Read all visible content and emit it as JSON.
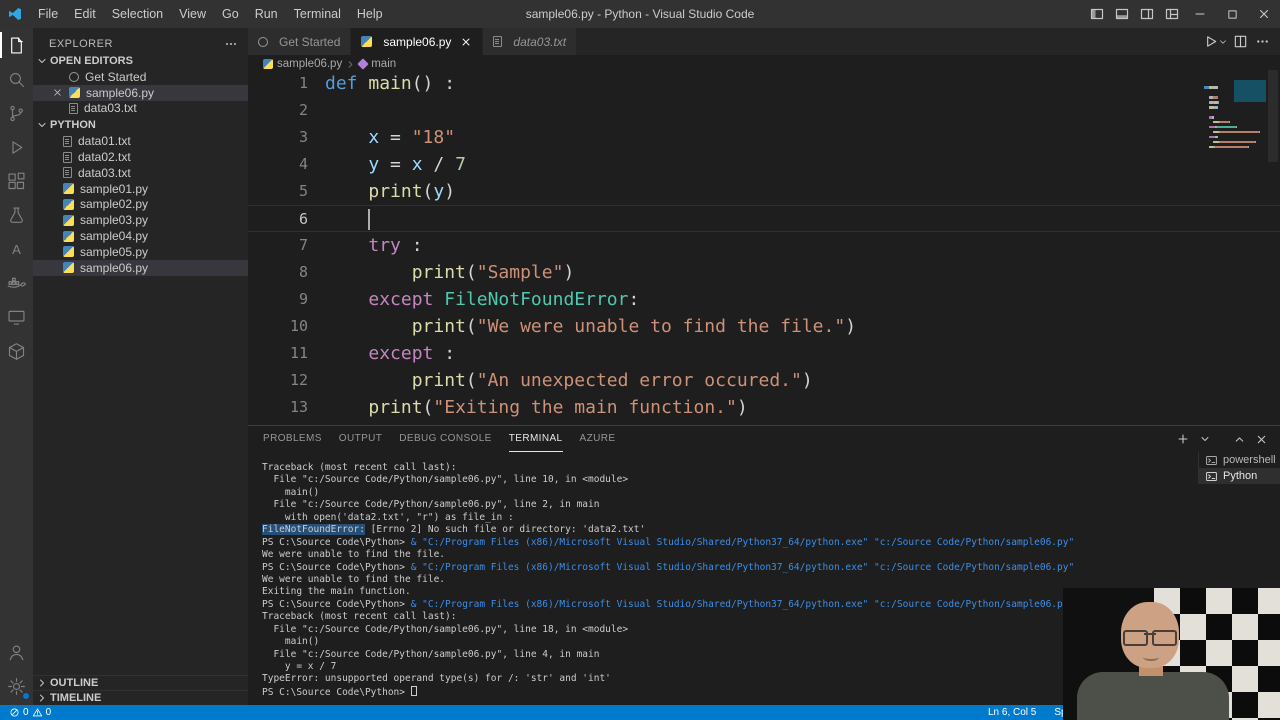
{
  "colors": {
    "accent": "#007acc",
    "python_icon_blue": "#4584b6",
    "python_icon_yellow": "#ffde57",
    "selection_highlight": "#264f78"
  },
  "title_bar": {
    "title": "sample06.py - Python - Visual Studio Code",
    "menus": [
      "File",
      "Edit",
      "Selection",
      "View",
      "Go",
      "Run",
      "Terminal",
      "Help"
    ]
  },
  "activity_bar": {
    "top": [
      {
        "name": "explorer",
        "icon": "explorer",
        "active": true
      },
      {
        "name": "search",
        "icon": "search"
      },
      {
        "name": "source-control",
        "icon": "source-control"
      },
      {
        "name": "run-and-debug",
        "icon": "run-debug"
      },
      {
        "name": "extensions",
        "icon": "extensions"
      },
      {
        "name": "testing",
        "icon": "testing"
      },
      {
        "name": "azure",
        "icon": "azure"
      },
      {
        "name": "docker",
        "icon": "docker"
      },
      {
        "name": "remote-explorer",
        "icon": "remote"
      },
      {
        "name": "package-explorer",
        "icon": "package"
      }
    ],
    "bottom": [
      {
        "name": "account",
        "icon": "account"
      },
      {
        "name": "settings",
        "icon": "settings",
        "badge": true
      }
    ]
  },
  "sidebar": {
    "header": "EXPLORER",
    "open_editors": {
      "label": "OPEN EDITORS",
      "items": [
        {
          "name": "Get Started",
          "icon": "gs"
        },
        {
          "name": "sample06.py",
          "icon": "py",
          "selected": true,
          "close_visible": true
        },
        {
          "name": "data03.txt",
          "icon": "txt"
        }
      ]
    },
    "folder": {
      "label": "PYTHON",
      "files": [
        {
          "name": "data01.txt",
          "icon": "txt"
        },
        {
          "name": "data02.txt",
          "icon": "txt"
        },
        {
          "name": "data03.txt",
          "icon": "txt"
        },
        {
          "name": "sample01.py",
          "icon": "py"
        },
        {
          "name": "sample02.py",
          "icon": "py"
        },
        {
          "name": "sample03.py",
          "icon": "py"
        },
        {
          "name": "sample04.py",
          "icon": "py"
        },
        {
          "name": "sample05.py",
          "icon": "py"
        },
        {
          "name": "sample06.py",
          "icon": "py",
          "selected": true
        }
      ]
    },
    "outline_label": "OUTLINE",
    "timeline_label": "TIMELINE"
  },
  "editor": {
    "tabs": [
      {
        "label": "Get Started",
        "icon": "gs",
        "state": "inactive"
      },
      {
        "label": "sample06.py",
        "icon": "py",
        "state": "active"
      },
      {
        "label": "data03.txt",
        "icon": "txt",
        "state": "preview"
      }
    ],
    "breadcrumb": [
      {
        "label": "sample06.py",
        "icon": "python"
      },
      {
        "label": "main",
        "icon": "symbol-method"
      }
    ],
    "cursor": {
      "line": 6,
      "col": 5
    },
    "code_lines": [
      {
        "num": 1,
        "indent": 0,
        "tokens": [
          [
            "def ",
            "kw"
          ],
          [
            "main",
            "fn"
          ],
          [
            "() :",
            "pl"
          ]
        ]
      },
      {
        "num": 2,
        "indent": 0,
        "tokens": []
      },
      {
        "num": 3,
        "indent": 1,
        "tokens": [
          [
            "x",
            "vr"
          ],
          [
            " = ",
            "pl"
          ],
          [
            "\"18\"",
            "st"
          ]
        ]
      },
      {
        "num": 4,
        "indent": 1,
        "tokens": [
          [
            "y",
            "vr"
          ],
          [
            " = ",
            "pl"
          ],
          [
            "x",
            "vr"
          ],
          [
            " / ",
            "pl"
          ],
          [
            "7",
            "nm"
          ]
        ]
      },
      {
        "num": 5,
        "indent": 1,
        "tokens": [
          [
            "print",
            "fn"
          ],
          [
            "(",
            "pl"
          ],
          [
            "y",
            "vr"
          ],
          [
            ")",
            "pl"
          ]
        ]
      },
      {
        "num": 6,
        "indent": 1,
        "tokens": [],
        "current": true
      },
      {
        "num": 7,
        "indent": 1,
        "tokens": [
          [
            "try",
            "ct"
          ],
          [
            " :",
            "pl"
          ]
        ]
      },
      {
        "num": 8,
        "indent": 2,
        "tokens": [
          [
            "print",
            "fn"
          ],
          [
            "(",
            "pl"
          ],
          [
            "\"Sample\"",
            "st"
          ],
          [
            ")",
            "pl"
          ]
        ]
      },
      {
        "num": 9,
        "indent": 1,
        "tokens": [
          [
            "except",
            "ct"
          ],
          [
            " ",
            "pl"
          ],
          [
            "FileNotFoundError",
            "cl"
          ],
          [
            ":",
            "pl"
          ]
        ]
      },
      {
        "num": 10,
        "indent": 2,
        "tokens": [
          [
            "print",
            "fn"
          ],
          [
            "(",
            "pl"
          ],
          [
            "\"We were unable to find the file.\"",
            "st"
          ],
          [
            ")",
            "pl"
          ]
        ]
      },
      {
        "num": 11,
        "indent": 1,
        "tokens": [
          [
            "except",
            "ct"
          ],
          [
            " :",
            "pl"
          ]
        ]
      },
      {
        "num": 12,
        "indent": 2,
        "tokens": [
          [
            "print",
            "fn"
          ],
          [
            "(",
            "pl"
          ],
          [
            "\"An unexpected error occured.\"",
            "st"
          ],
          [
            ")",
            "pl"
          ]
        ]
      },
      {
        "num": 13,
        "indent": 1,
        "tokens": [
          [
            "print",
            "fn"
          ],
          [
            "(",
            "pl"
          ],
          [
            "\"Exiting the main function.\"",
            "st"
          ],
          [
            ")",
            "pl"
          ]
        ]
      }
    ]
  },
  "panel": {
    "tabs": [
      {
        "label": "PROBLEMS"
      },
      {
        "label": "OUTPUT"
      },
      {
        "label": "DEBUG CONSOLE"
      },
      {
        "label": "TERMINAL",
        "active": true
      },
      {
        "label": "AZURE"
      }
    ],
    "terminal": {
      "lines": [
        [
          [
            "Traceback (most recent call last):",
            "p"
          ]
        ],
        [
          [
            "  File \"c:/Source Code/Python/sample06.py\", line 10, in <module>",
            "p"
          ]
        ],
        [
          [
            "    main()",
            "p"
          ]
        ],
        [
          [
            "  File \"c:/Source Code/Python/sample06.py\", line 2, in main",
            "p"
          ]
        ],
        [
          [
            "    with open('data2.txt', \"r\") as file_in :",
            "p"
          ]
        ],
        [
          [
            "FileNotFoundError:",
            "h"
          ],
          [
            " [Errno 2] No such file or directory: 'data2.txt'",
            "p"
          ]
        ],
        [
          [
            "PS C:\\Source Code\\Python> ",
            "p"
          ],
          [
            "& \"C:/Program Files (x86)/Microsoft Visual Studio/Shared/Python37_64/python.exe\" \"c:/Source Code/Python/sample06.py\"",
            "c"
          ]
        ],
        [
          [
            "We were unable to find the file.",
            "p"
          ]
        ],
        [
          [
            "PS C:\\Source Code\\Python> ",
            "p"
          ],
          [
            "& \"C:/Program Files (x86)/Microsoft Visual Studio/Shared/Python37_64/python.exe\" \"c:/Source Code/Python/sample06.py\"",
            "c"
          ]
        ],
        [
          [
            "We were unable to find the file.",
            "p"
          ]
        ],
        [
          [
            "Exiting the main function.",
            "p"
          ]
        ],
        [
          [
            "PS C:\\Source Code\\Python> ",
            "p"
          ],
          [
            "& \"C:/Program Files (x86)/Microsoft Visual Studio/Shared/Python37_64/python.exe\" \"c:/Source Code/Python/sample06.py\"",
            "c"
          ]
        ],
        [
          [
            "Traceback (most recent call last):",
            "p"
          ]
        ],
        [
          [
            "  File \"c:/Source Code/Python/sample06.py\", line 18, in <module>",
            "p"
          ]
        ],
        [
          [
            "    main()",
            "p"
          ]
        ],
        [
          [
            "  File \"c:/Source Code/Python/sample06.py\", line 4, in main",
            "p"
          ]
        ],
        [
          [
            "    y = x / 7",
            "p"
          ]
        ],
        [
          [
            "TypeError: unsupported operand type(s) for /: 'str' and 'int'",
            "p"
          ]
        ],
        [
          [
            "PS C:\\Source Code\\Python> ",
            "p"
          ],
          [
            "",
            "cur"
          ]
        ]
      ],
      "sidebar": [
        {
          "label": "powershell"
        },
        {
          "label": "Python",
          "selected": true
        }
      ]
    }
  },
  "status_bar": {
    "errors": "0",
    "warnings": "0",
    "cursor_position": "Ln 6, Col 5",
    "indentation": "Spaces: 4"
  }
}
